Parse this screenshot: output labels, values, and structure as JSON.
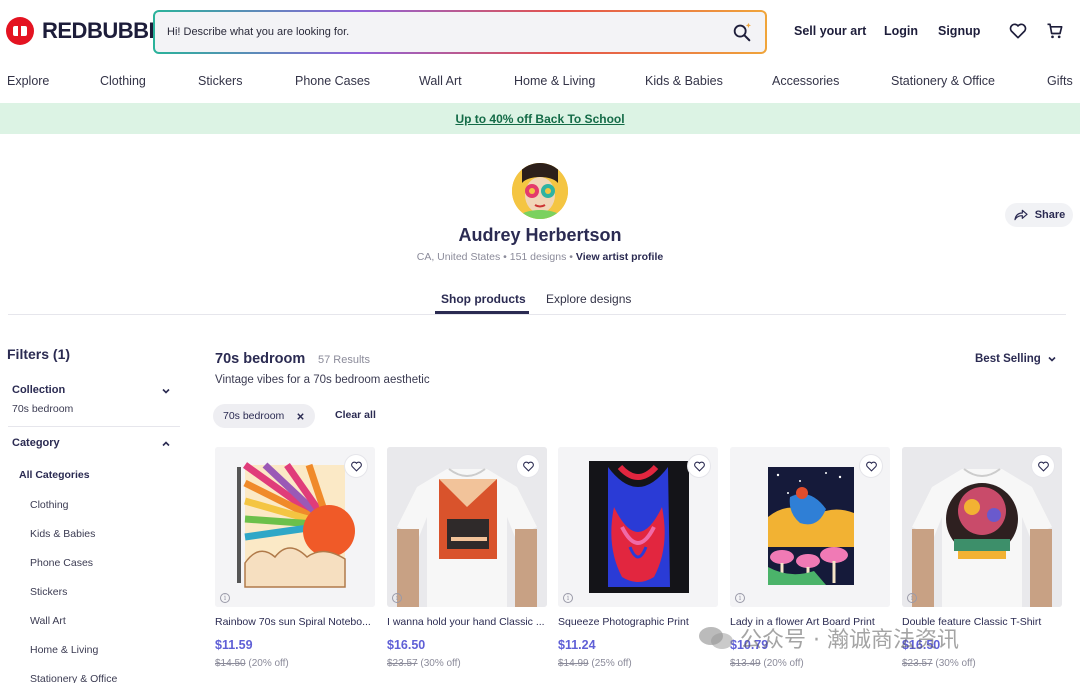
{
  "header": {
    "logo_text": "REDBUBBLE",
    "search_placeholder": "Hi! Describe what you are looking for.",
    "sell_label": "Sell your art",
    "login_label": "Login",
    "signup_label": "Signup"
  },
  "nav": {
    "items": [
      "Explore",
      "Clothing",
      "Stickers",
      "Phone Cases",
      "Wall Art",
      "Home & Living",
      "Kids & Babies",
      "Accessories",
      "Stationery & Office",
      "Gifts"
    ]
  },
  "promo": {
    "text": "Up to 40% off Back To School",
    "color": "#dcf3e4"
  },
  "profile": {
    "name": "Audrey Herbertson",
    "location": "CA, United States",
    "designs": "151 designs",
    "view_profile": "View artist profile",
    "share_label": "Share"
  },
  "tabs": {
    "shop": "Shop products",
    "explore": "Explore designs"
  },
  "sidebar": {
    "filters_title": "Filters (1)",
    "collection_label": "Collection",
    "collection_value": "70s bedroom",
    "category_label": "Category",
    "all_categories": "All Categories",
    "categories": [
      "Clothing",
      "Kids & Babies",
      "Phone Cases",
      "Stickers",
      "Wall Art",
      "Home & Living",
      "Stationery & Office"
    ]
  },
  "collection": {
    "title": "70s bedroom",
    "results": "57 Results",
    "description": "Vintage vibes for a 70s bedroom aesthetic",
    "sort_label": "Best Selling",
    "chip_label": "70s bedroom",
    "clear_all": "Clear all"
  },
  "products": [
    {
      "title": "Rainbow 70s sun Spiral Notebo...",
      "price": "$11.59",
      "original": "$14.50",
      "discount": "(20% off)"
    },
    {
      "title": "I wanna hold your hand Classic ...",
      "price": "$16.50",
      "original": "$23.57",
      "discount": "(30% off)"
    },
    {
      "title": "Squeeze Photographic Print",
      "price": "$11.24",
      "original": "$14.99",
      "discount": "(25% off)"
    },
    {
      "title": "Lady in a flower Art Board Print",
      "price": "$10.79",
      "original": "$13.49",
      "discount": "(20% off)"
    },
    {
      "title": "Double feature Classic T-Shirt",
      "price": "$16.50",
      "original": "$23.57",
      "discount": "(30% off)"
    }
  ],
  "watermark": {
    "text": "公众号 · 瀚诚商法资讯"
  },
  "colors": {
    "brand": "#e41321",
    "accent": "#5f5fd6",
    "ink": "#2b2b52"
  }
}
